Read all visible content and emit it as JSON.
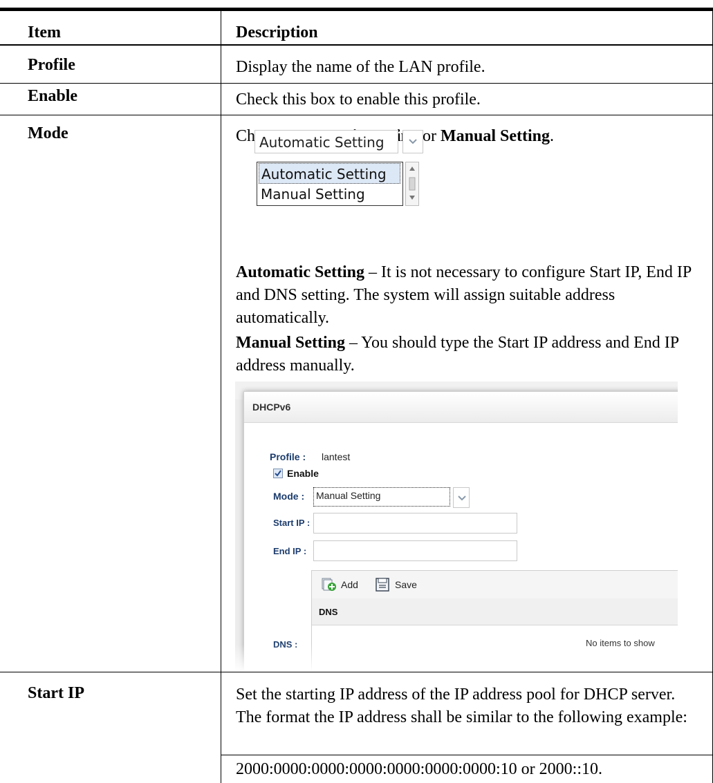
{
  "header": {
    "item": "Item",
    "description": "Description"
  },
  "rows": [
    {
      "item": "Profile",
      "description": "Display the name of the LAN profile."
    },
    {
      "item": "Enable",
      "description": "Check this box to enable this profile."
    },
    {
      "item": "Mode",
      "intro_prefix": "Choose ",
      "intro_opt1": "Automatic Setting",
      "intro_mid": " or ",
      "intro_opt2": "Manual Setting",
      "intro_suffix": ".",
      "auto_term": "Automatic Setting",
      "auto_text": " – It is not necessary to configure Start IP, End IP and DNS setting. The system will assign suitable address automatically.",
      "manual_term": "Manual Setting",
      "manual_text": " – You should type the Start IP address and End IP address manually."
    },
    {
      "item": "Start IP",
      "description": "Set the starting IP address of the IP address pool for DHCP server. The format the IP address shall be similar to the following example:",
      "example": "2000:0000:0000:0000:0000:0000:0000:10 or 2000::10."
    }
  ],
  "dropdown_illustration": {
    "selected": "Automatic Setting",
    "options": [
      "Automatic Setting",
      "Manual Setting"
    ]
  },
  "dialog": {
    "title": "DHCPv6",
    "profile_label": "Profile :",
    "profile_value": "lantest",
    "enable_label": "Enable",
    "enable_checked": true,
    "mode_label": "Mode :",
    "mode_value": "Manual Setting",
    "start_ip_label": "Start IP :",
    "end_ip_label": "End IP :",
    "dns_label": "DNS :",
    "add_button": "Add",
    "save_button": "Save",
    "grid_column": "DNS",
    "empty_text": "No items to show"
  }
}
